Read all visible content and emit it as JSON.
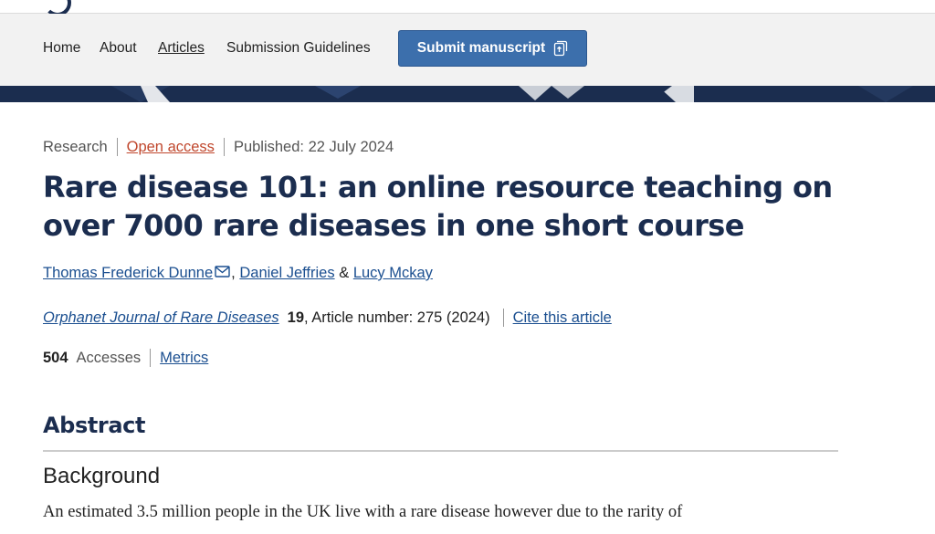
{
  "nav": {
    "items": [
      "Home",
      "About",
      "Articles",
      "Submission Guidelines"
    ],
    "submit_label": "Submit manuscript",
    "submit_icon": "external-link-icon"
  },
  "colors": {
    "brand_navy": "#1b2d4f",
    "button_blue": "#3c6fac",
    "open_access": "#c0472d",
    "link": "#1b4f90"
  },
  "article": {
    "type": "Research",
    "access": "Open access",
    "published": "Published: 22 July 2024",
    "title": "Rare disease 101: an online resource teaching on over 7000 rare diseases in one short course",
    "authors": [
      "Thomas Frederick Dunne",
      "Daniel Jeffries",
      "Lucy Mckay"
    ],
    "author_separator_1": ",",
    "author_separator_2": "&",
    "corresponding_icon": "mail-icon",
    "journal": "Orphanet Journal of Rare Diseases",
    "volume": "19",
    "article_number": ", Article number: 275 (2024)",
    "cite_label": "Cite this article",
    "accesses_count": "504",
    "accesses_label": "Accesses",
    "metrics_label": "Metrics"
  },
  "abstract": {
    "heading": "Abstract",
    "section_heading": "Background",
    "text": "An estimated 3.5 million people in the UK live with a rare disease however due to the rarity of"
  }
}
